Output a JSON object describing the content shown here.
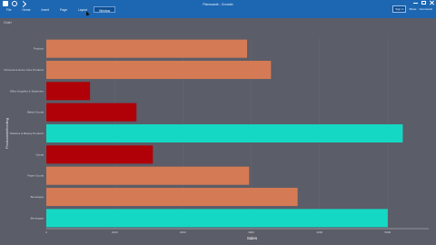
{
  "window": {
    "title": "Planosante - Grunder"
  },
  "ribbon": {
    "tabs": [
      {
        "label": "File"
      },
      {
        "label": "Home"
      },
      {
        "label": "Insert"
      },
      {
        "label": "Page"
      },
      {
        "label": "Layout"
      },
      {
        "label": "Window"
      }
    ],
    "active_tab": 5,
    "sign_in": "Sign in",
    "right_items": [
      "Share",
      "Comments"
    ]
  },
  "canvas": {
    "label": "Chart"
  },
  "colors": {
    "background": "#5b5d68",
    "titlebar": "#1d67b2",
    "orange": "#d47a55",
    "red": "#b00008",
    "teal": "#15d8c4"
  },
  "chart_data": {
    "type": "bar",
    "orientation": "horizontal",
    "ylabel": "Productshelfcoding",
    "xlabel": "Sales",
    "xlim": [
      0,
      5600
    ],
    "xticks": [
      "0",
      "1000",
      "2000",
      "3000",
      "4000",
      "5000"
    ],
    "categories": [
      "Produce",
      "Personal & Home Care Products",
      "Office Supplies & Stationery",
      "Baked Goods",
      "Toiletries & Beauty Products",
      "Candy",
      "Paper Goods",
      "Beverages",
      "Beverages"
    ],
    "values": [
      2940,
      3290,
      640,
      1320,
      5220,
      1560,
      2970,
      3680,
      5000
    ],
    "bar_colors": [
      "orange",
      "orange",
      "red",
      "red",
      "teal",
      "red",
      "orange",
      "orange",
      "teal"
    ]
  }
}
